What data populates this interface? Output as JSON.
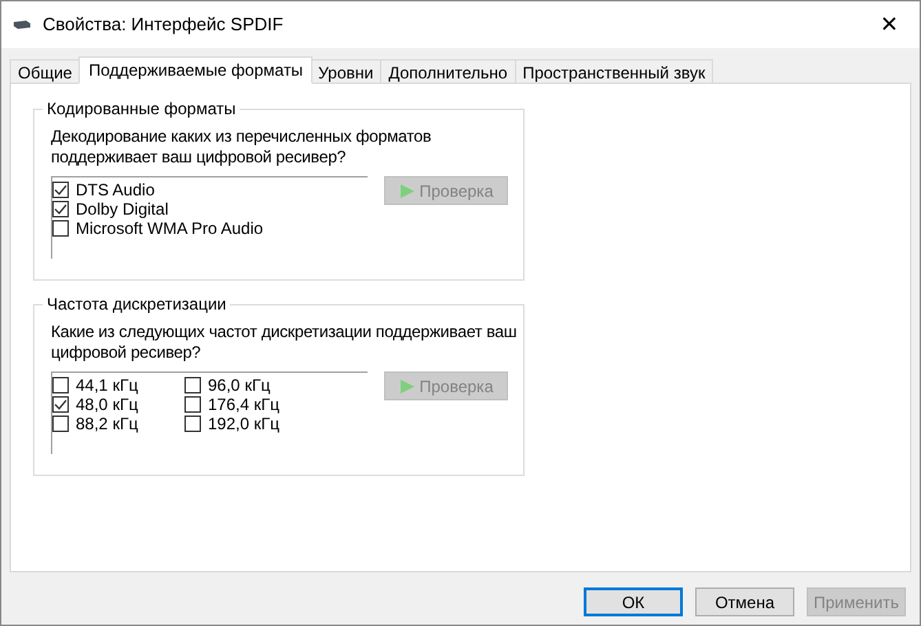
{
  "window": {
    "title": "Свойства: Интерфейс SPDIF",
    "close": "✕"
  },
  "tabs": [
    {
      "label": "Общие",
      "selected": false
    },
    {
      "label": "Поддерживаемые форматы",
      "selected": true
    },
    {
      "label": "Уровни",
      "selected": false
    },
    {
      "label": "Дополнительно",
      "selected": false
    },
    {
      "label": "Пространственный звук",
      "selected": false
    }
  ],
  "groups": [
    {
      "title": "Кодированные форматы",
      "question": "Декодирование каких из перечисленных форматов поддерживает ваш цифровой ресивер?",
      "test_button": {
        "label": "Проверка",
        "disabled": true
      },
      "columns": [
        [
          {
            "label": "DTS Audio",
            "checked": true
          },
          {
            "label": "Dolby Digital",
            "checked": true
          },
          {
            "label": "Microsoft WMA Pro Audio",
            "checked": false
          }
        ]
      ]
    },
    {
      "title": "Частота дискретизации",
      "question": "Какие из следующих частот дискретизации поддерживает ваш цифровой ресивер?",
      "test_button": {
        "label": "Проверка",
        "disabled": true
      },
      "columns": [
        [
          {
            "label": "44,1 кГц",
            "checked": false
          },
          {
            "label": "48,0 кГц",
            "checked": true
          },
          {
            "label": "88,2 кГц",
            "checked": false
          }
        ],
        [
          {
            "label": "96,0 кГц",
            "checked": false
          },
          {
            "label": "176,4 кГц",
            "checked": false
          },
          {
            "label": "192,0 кГц",
            "checked": false
          }
        ]
      ]
    }
  ],
  "buttons": [
    {
      "label": "ОК",
      "default": true,
      "disabled": false
    },
    {
      "label": "Отмена",
      "default": false,
      "disabled": false
    },
    {
      "label": "Применить",
      "default": false,
      "disabled": true
    }
  ]
}
